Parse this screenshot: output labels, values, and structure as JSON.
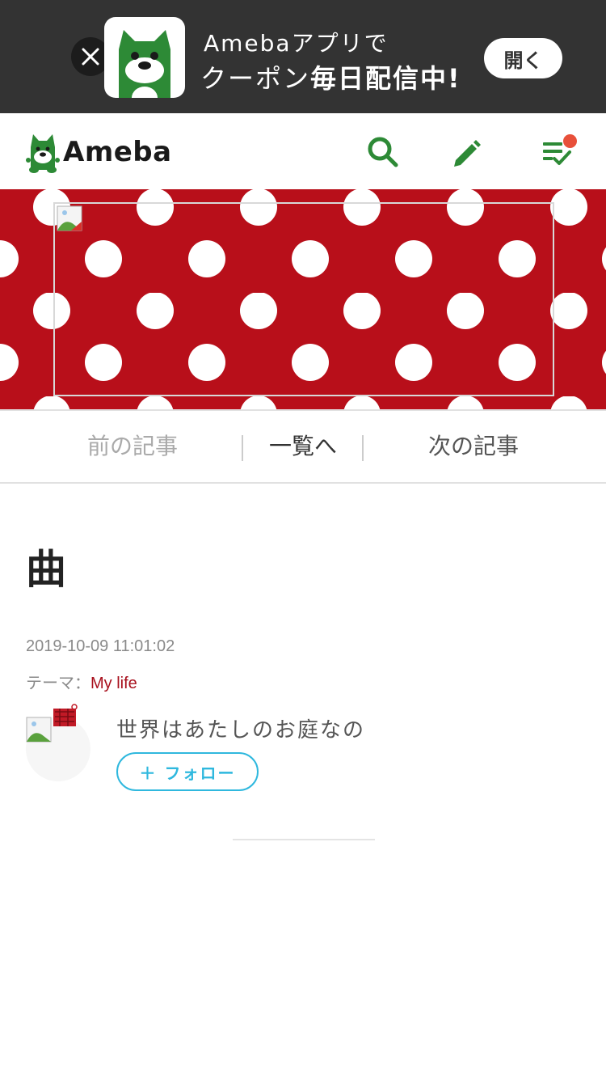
{
  "app_banner": {
    "line1": "Amebaアプリで",
    "line2_prefix": "クーポン",
    "line2_bold": "毎日配信中!",
    "open_label": "開く",
    "close_icon": "close-icon",
    "app_icon": "ameba-app-icon"
  },
  "header": {
    "logo_text": "Ameba",
    "icons": [
      "search-icon",
      "pencil-icon",
      "checklist-icon"
    ],
    "accent_color": "#2d8a36",
    "notification_color": "#e8503a"
  },
  "blog_header": {
    "background_color": "#b80f1a",
    "pattern": "white polka dots",
    "image": "broken-image-icon"
  },
  "pager": {
    "prev_label": "前の記事",
    "list_label": "一覧へ",
    "next_label": "次の記事"
  },
  "entry": {
    "title": "曲",
    "date": "2019-10-09 11:01:02",
    "theme_label": "テーマ：",
    "theme_value": "My life",
    "theme_color": "#a8101d"
  },
  "author": {
    "blog_name": "世界はあたしのお庭なの",
    "follow_label": "＋ フォロー",
    "follow_color": "#2fb8de"
  }
}
